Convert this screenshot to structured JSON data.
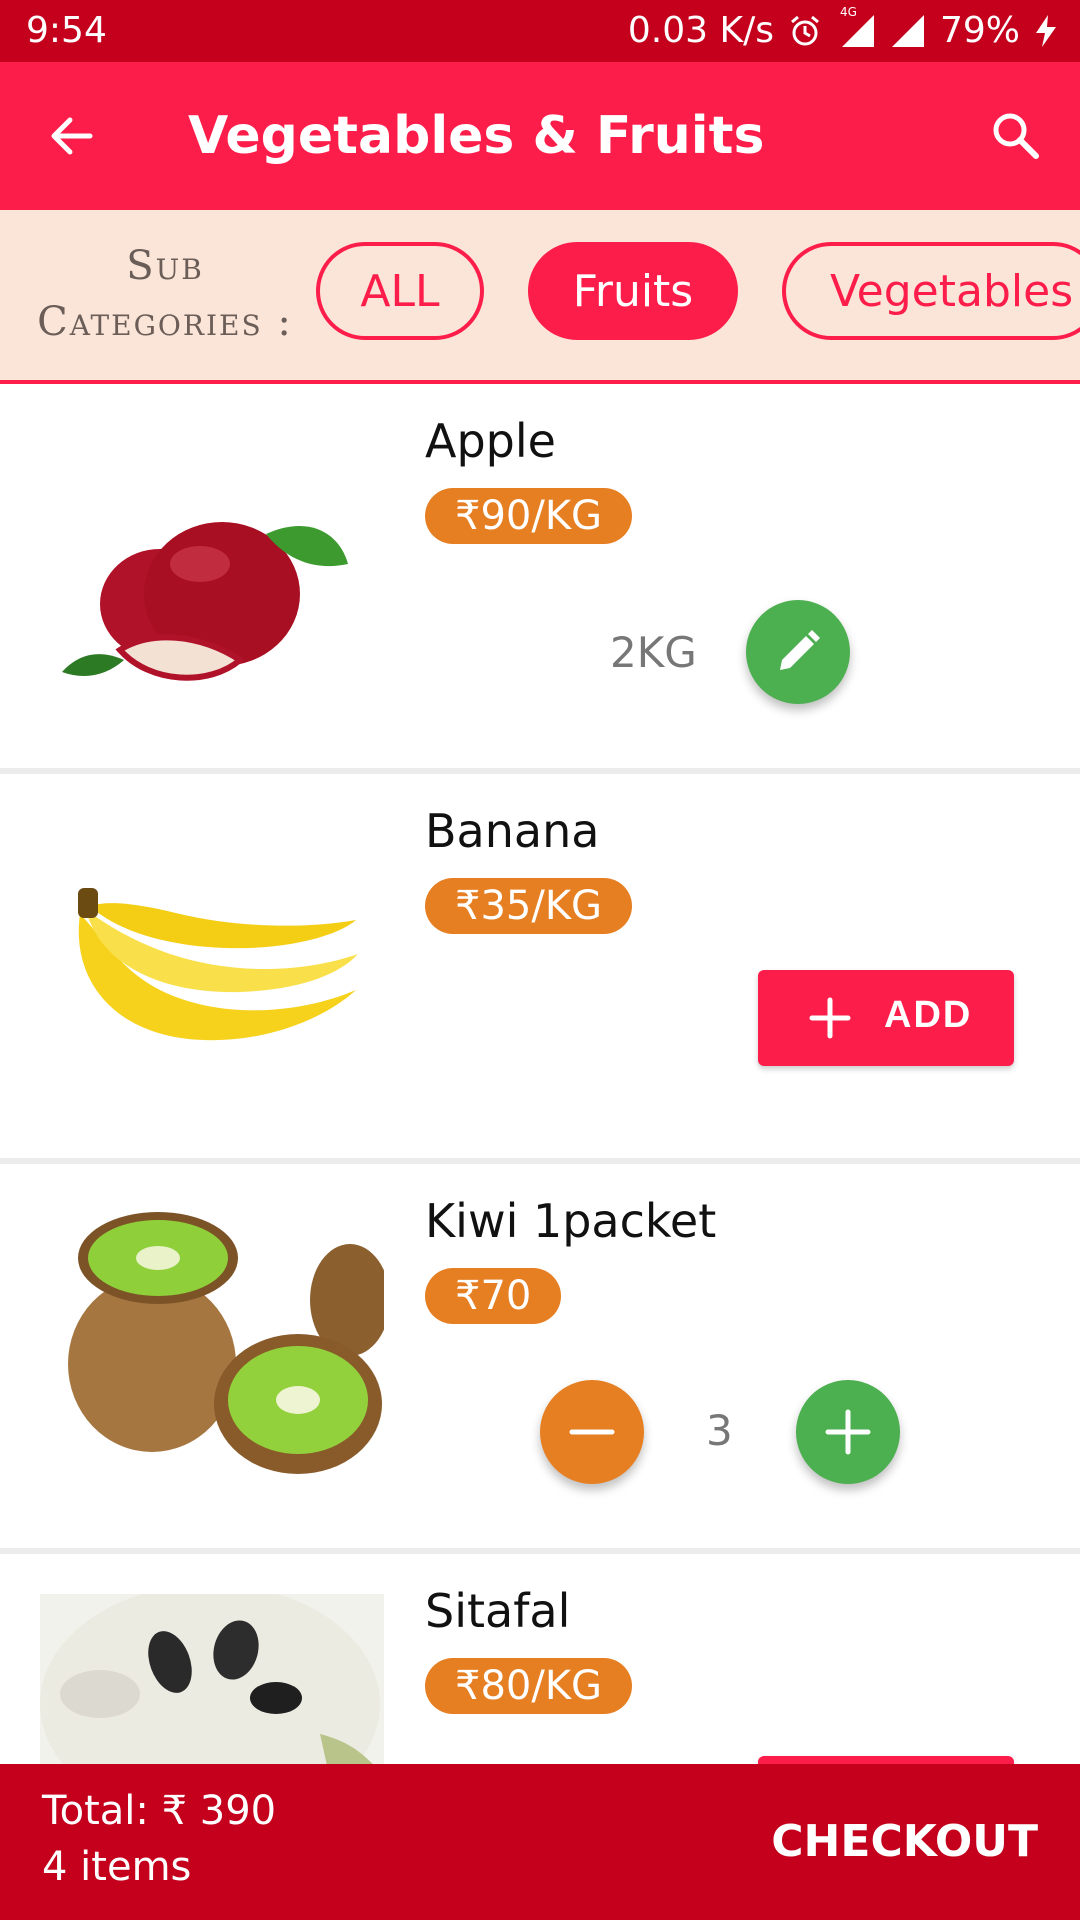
{
  "statusbar": {
    "time": "9:54",
    "network_speed": "0.03 K/s",
    "network_type": "4G",
    "battery": "79%",
    "icons": [
      "alarm-icon",
      "signal-icon",
      "wifi-signal-icon",
      "charging-icon"
    ]
  },
  "appbar": {
    "title": "Vegetables & Fruits",
    "back_icon": "arrow-left-icon",
    "search_icon": "search-icon"
  },
  "subcategories": {
    "label_line1": "Sub",
    "label_line2": "Categories :",
    "chips": [
      {
        "label": "ALL",
        "selected": false
      },
      {
        "label": "Fruits",
        "selected": true
      },
      {
        "label": "Vegetables",
        "selected": false
      }
    ]
  },
  "products": [
    {
      "name": "Apple",
      "price": "₹90/KG",
      "image": "apple-image",
      "quantity": "2KG",
      "action": "edit"
    },
    {
      "name": "Banana",
      "price": "₹35/KG",
      "image": "banana-image",
      "action": "add",
      "add_label": "ADD"
    },
    {
      "name": "Kiwi 1packet",
      "price": "₹70",
      "image": "kiwi-image",
      "quantity": "3",
      "action": "stepper"
    },
    {
      "name": "Sitafal",
      "price": "₹80/KG",
      "image": "sitafal-image",
      "action": "add"
    }
  ],
  "footer": {
    "total": "Total: ₹ 390",
    "items": "4 items",
    "checkout_label": "CHECKOUT"
  },
  "colors": {
    "primary": "#fd1d4a",
    "primary_dark": "#c4001d",
    "subcategory_bg": "#fbe5d8",
    "price_badge": "#e67e22",
    "fab_green": "#4caf50",
    "fab_orange": "#e67e22"
  }
}
